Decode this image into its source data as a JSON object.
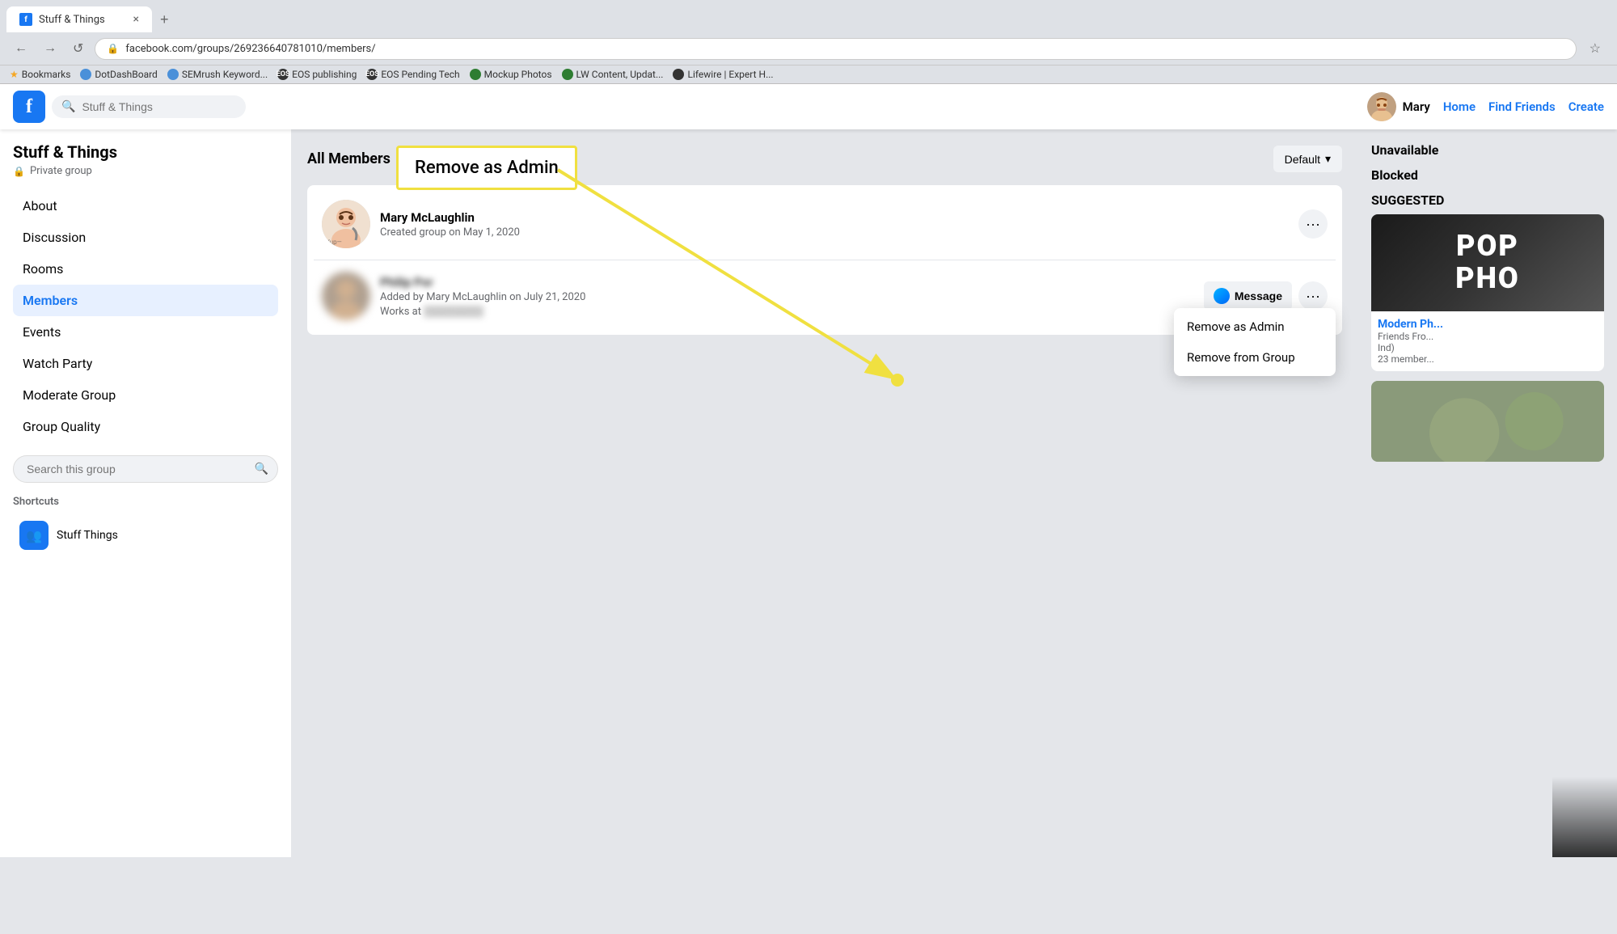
{
  "browser": {
    "tab_favicon": "f",
    "tab_title": "Stuff & Things",
    "tab_close": "×",
    "tab_new": "+",
    "nav_back": "←",
    "nav_forward": "→",
    "nav_refresh": "↺",
    "url": "facebook.com/groups/269236640781010/members/",
    "url_lock": "🔒",
    "star": "☆",
    "bookmarks_label": "Bookmarks",
    "bookmarks": [
      {
        "label": "DotDashBoard",
        "color": "#4a90d9"
      },
      {
        "label": "SEMrush Keyword...",
        "color": "#4a90d9"
      },
      {
        "label": "EOS publishing",
        "color": "#333"
      },
      {
        "label": "EOS Pending Tech",
        "color": "#333"
      },
      {
        "label": "Mockup Photos",
        "color": "#2e7d32"
      },
      {
        "label": "LW Content, Updat...",
        "color": "#2e7d32"
      },
      {
        "label": "Lifewire | Expert H...",
        "color": "#333"
      }
    ]
  },
  "header": {
    "logo": "f",
    "search_placeholder": "Stuff & Things",
    "search_icon": "🔍",
    "user_name": "Mary",
    "nav_home": "Home",
    "nav_find_friends": "Find Friends",
    "nav_create": "Create"
  },
  "sidebar": {
    "group_name": "Stuff & Things",
    "group_type": "Private group",
    "lock_icon": "🔒",
    "nav_items": [
      {
        "label": "About",
        "active": false
      },
      {
        "label": "Discussion",
        "active": false
      },
      {
        "label": "Rooms",
        "active": false
      },
      {
        "label": "Members",
        "active": true
      },
      {
        "label": "Events",
        "active": false
      },
      {
        "label": "Watch Party",
        "active": false
      },
      {
        "label": "Moderate Group",
        "active": false
      },
      {
        "label": "Group Quality",
        "active": false
      }
    ],
    "search_placeholder": "Search this group",
    "search_icon": "🔍",
    "shortcuts_title": "Shortcuts",
    "shortcut_items": [
      {
        "label": "Stuff Things",
        "icon": "👥"
      }
    ]
  },
  "members": {
    "title": "All Members",
    "default_btn": "Default",
    "chevron": "▾",
    "list": [
      {
        "name": "Mary McLaughlin",
        "meta": "Created group on May 1, 2020",
        "more_btn": "···"
      },
      {
        "name": "Philip Por",
        "meta_added": "Added by Mary McLaughlin on July 21, 2020",
        "meta_works": "Works at ▒▒▒▒▒▒▒▒",
        "message_btn": "Message",
        "more_btn": "···",
        "blurred": true
      }
    ]
  },
  "dropdown": {
    "items": [
      {
        "label": "Remove as Admin"
      },
      {
        "label": "Remove from Group"
      }
    ]
  },
  "annotation": {
    "label": "Remove as Admin"
  },
  "right_sidebar": {
    "unavailable_title": "Unavailable",
    "blocked_title": "Blocked",
    "suggested_title": "SUGGESTED",
    "suggested_groups": [
      {
        "image_text": "POP\nPHO",
        "name": "Modern Ph...",
        "meta": "Friends Fro...\nInd)\n23 member..."
      }
    ]
  }
}
